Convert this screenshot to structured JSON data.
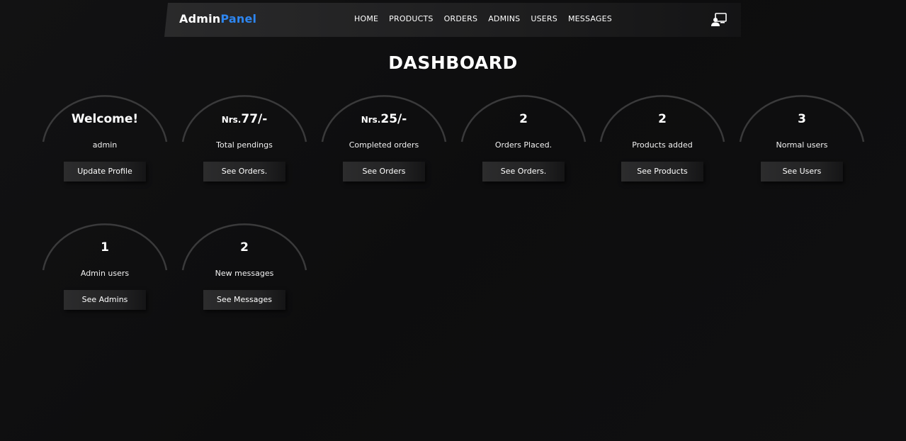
{
  "brand": {
    "part1": "Admin",
    "part2": "Panel"
  },
  "nav": {
    "home": "HOME",
    "products": "PRODUCTS",
    "orders": "ORDERS",
    "admins": "ADMINS",
    "users": "USERS",
    "messages": "MESSAGES"
  },
  "header": {
    "user_icon": "user-monitor-icon"
  },
  "page": {
    "title": "DASHBOARD"
  },
  "cards": [
    {
      "prefix": "",
      "value": "Welcome!",
      "label": "admin",
      "button": "Update Profile"
    },
    {
      "prefix": "Nrs.",
      "value": "77/-",
      "label": "Total pendings",
      "button": "See Orders."
    },
    {
      "prefix": "Nrs.",
      "value": "25/-",
      "label": "Completed orders",
      "button": "See Orders"
    },
    {
      "prefix": "",
      "value": "2",
      "label": "Orders Placed.",
      "button": "See Orders."
    },
    {
      "prefix": "",
      "value": "2",
      "label": "Products added",
      "button": "See Products"
    },
    {
      "prefix": "",
      "value": "3",
      "label": "Normal users",
      "button": "See Users"
    },
    {
      "prefix": "",
      "value": "1",
      "label": "Admin users",
      "button": "See Admins"
    },
    {
      "prefix": "",
      "value": "2",
      "label": "New messages",
      "button": "See Messages"
    }
  ],
  "colors": {
    "background": "#0e0e0f",
    "accent": "#2e86f0",
    "text": "#ffffff"
  }
}
